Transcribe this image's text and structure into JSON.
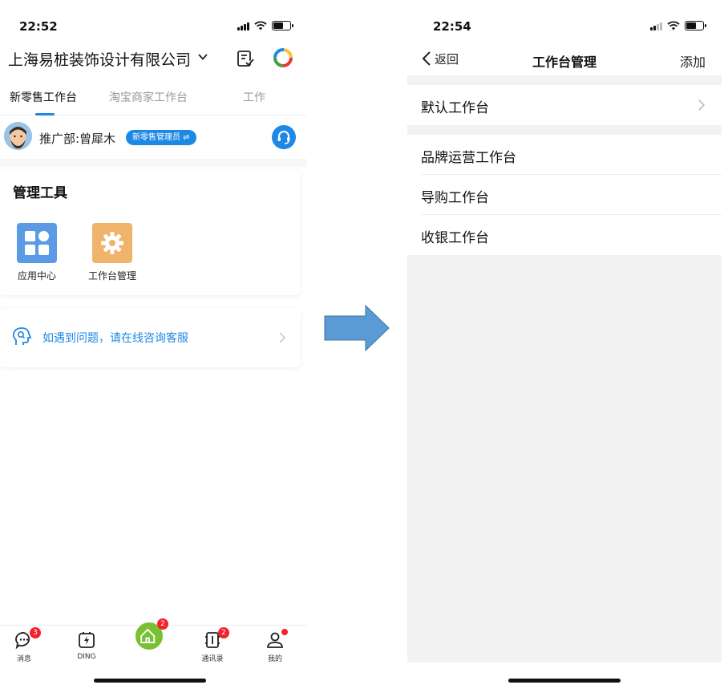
{
  "left_screen": {
    "status_bar": {
      "time": "22:52"
    },
    "header": {
      "company_name": "上海易桩装饰设计有限公司",
      "icons": [
        "chevron-down-icon",
        "todo-icon",
        "app-logo-icon"
      ]
    },
    "tabs": [
      {
        "label": "新零售工作台",
        "active": true
      },
      {
        "label": "淘宝商家工作台",
        "active": false
      },
      {
        "label": "工作",
        "active": false
      }
    ],
    "user": {
      "name": "推广部:曾犀木",
      "role_badge": "新零售管理员 ⇌"
    },
    "tools_card": {
      "title": "管理工具",
      "items": [
        {
          "label": "应用中心",
          "icon": "app-center-icon",
          "color": "#5b9be6"
        },
        {
          "label": "工作台管理",
          "icon": "gear-icon",
          "color": "#f0b36b"
        }
      ]
    },
    "help_card": {
      "text": "如遇到问题，请在线咨询客服"
    },
    "bottom_tabs": [
      {
        "label": "消息",
        "icon": "message-icon",
        "badge": "3"
      },
      {
        "label": "DING",
        "icon": "ding-icon"
      },
      {
        "label": "",
        "icon": "home-icon",
        "badge": "2"
      },
      {
        "label": "通讯录",
        "icon": "contacts-icon",
        "badge": "2"
      },
      {
        "label": "我的",
        "icon": "profile-icon",
        "dot": true
      }
    ]
  },
  "right_screen": {
    "status_bar": {
      "time": "22:54"
    },
    "nav": {
      "back_label": "返回",
      "title": "工作台管理",
      "add_label": "添加"
    },
    "default_section": {
      "label": "默认工作台"
    },
    "workbenches": [
      {
        "label": "品牌运营工作台"
      },
      {
        "label": "导购工作台"
      },
      {
        "label": "收银工作台"
      }
    ]
  },
  "colors": {
    "accent_blue": "#1e88e5",
    "arrow_blue": "#5b9bd5",
    "badge_red": "#f5222d",
    "home_green": "#78c135"
  }
}
